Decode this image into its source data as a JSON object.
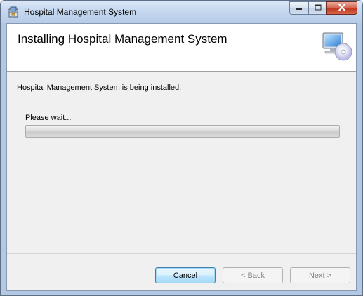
{
  "window": {
    "title": "Hospital Management System"
  },
  "banner": {
    "title": "Installing Hospital Management System"
  },
  "body": {
    "status_text": "Hospital Management System is being installed.",
    "wait_label": "Please wait...",
    "progress": 0.0
  },
  "buttons": {
    "cancel": "Cancel",
    "back": "< Back",
    "next": "Next >"
  },
  "icons": {
    "app": "installer-icon",
    "banner": "computer-cd-icon",
    "minimize": "minimize-icon",
    "maximize": "maximize-icon",
    "close": "close-icon"
  },
  "colors": {
    "close_button": "#c0391f",
    "default_button_border": "#3c7fb1",
    "client_background": "#f0f0f0"
  }
}
